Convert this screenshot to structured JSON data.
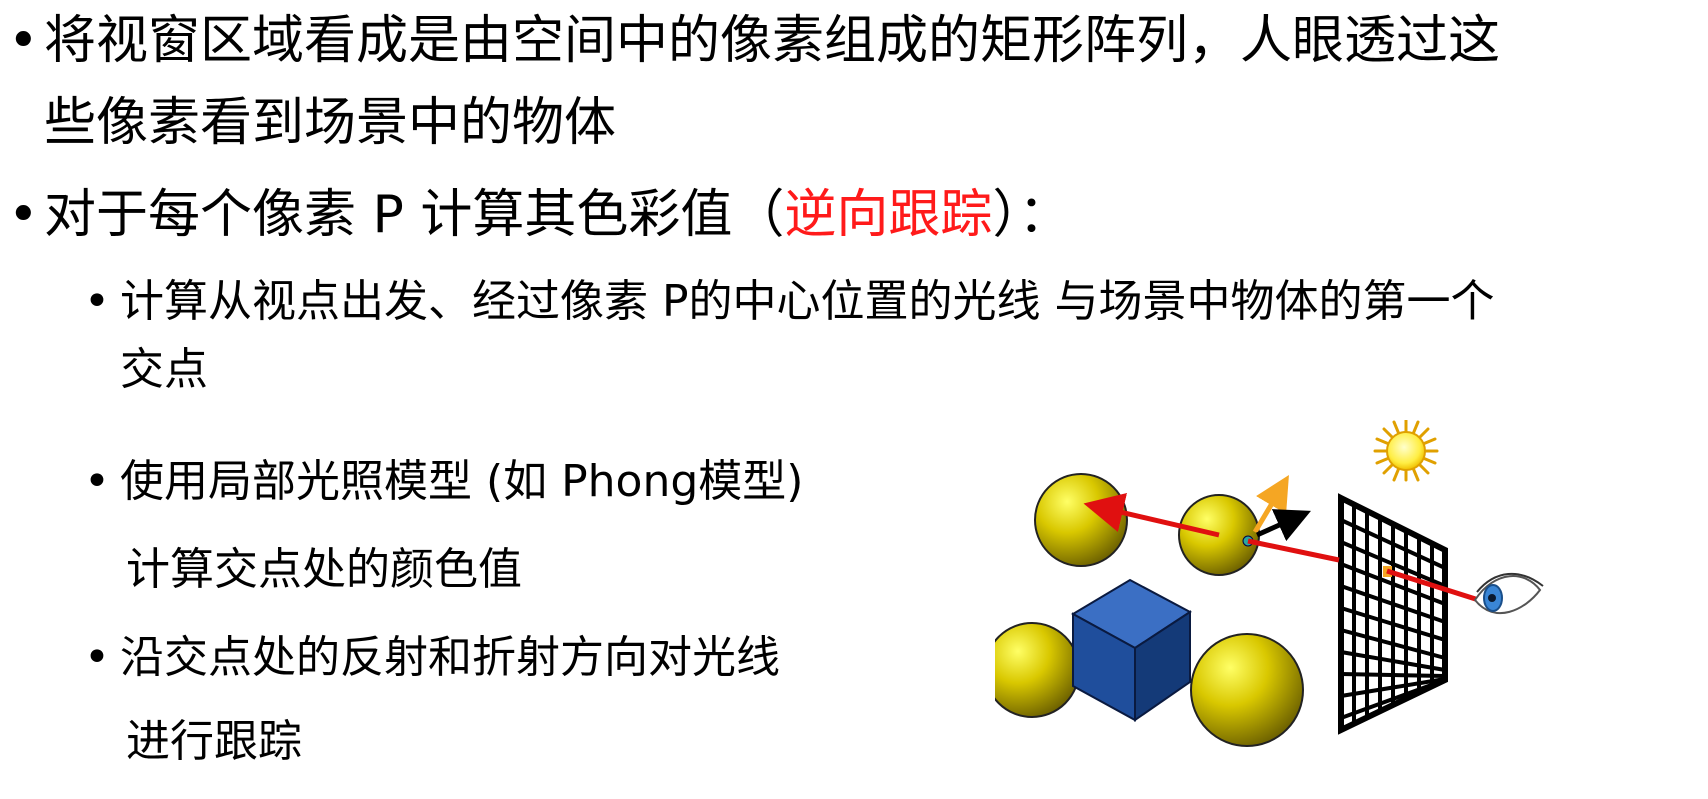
{
  "bullets": [
    {
      "marker": "•",
      "text_line1": "将视窗区域看成是由空间中的像素组成的矩形阵列，人眼透过这",
      "text_line2": "些像素看到场景中的物体"
    },
    {
      "marker": "•",
      "text_before": "对于每个像素 P 计算其色彩值（",
      "text_highlight": "逆向跟踪",
      "text_after": "）："
    }
  ],
  "sub_bullets": [
    {
      "marker": "•",
      "text_line1": "计算从视点出发、经过像素 P的中心位置的光线 与场景中物体的第一个",
      "text_line2": "交点"
    },
    {
      "marker": "•",
      "text_line1": "使用局部光照模型 (如 Phong模型)",
      "text_line2": "计算交点处的颜色值"
    },
    {
      "marker": "•",
      "text_line1": "沿交点处的反射和折射方向对光线",
      "text_line2": "进行跟踪"
    }
  ],
  "colors": {
    "highlight": "#ff1a1a",
    "sphere": "#d9c800",
    "cube": "#1f4e9c",
    "ray": "#e01010",
    "light_ray": "#f5a623",
    "reflect_ray": "#000000"
  },
  "icons": {
    "sun": "sun-icon",
    "eye": "eye-icon"
  }
}
